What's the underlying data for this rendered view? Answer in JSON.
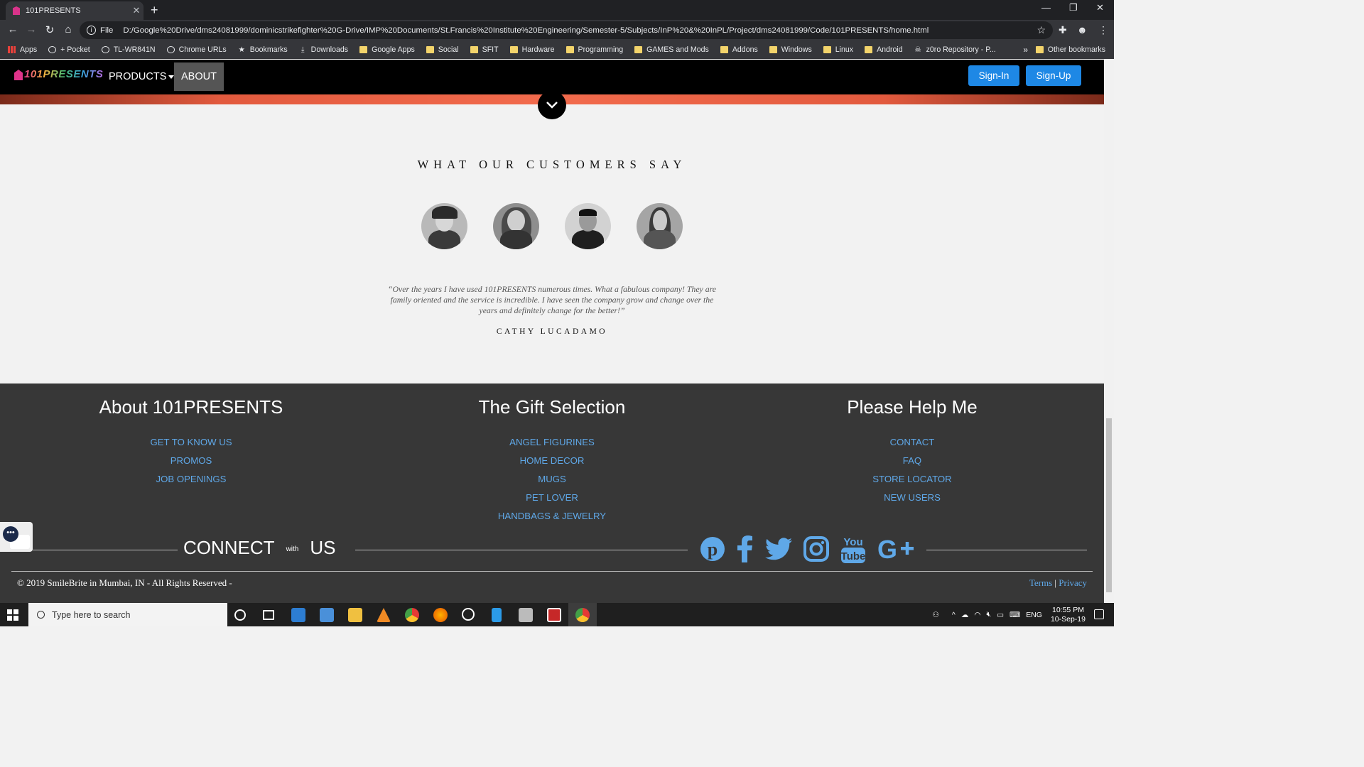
{
  "browser": {
    "tab_title": "101PRESENTS",
    "tab_close": "✕",
    "new_tab": "+",
    "window_controls": {
      "minimize": "—",
      "restore": "❐",
      "close": "✕"
    },
    "url_scheme": "File",
    "url": "D:/Google%20Drive/dms24081999/dominicstrikefighter%20G-Drive/IMP%20Documents/St.Francis%20Institute%20Engineering/Semester-5/Subjects/InP%20&%20InPL/Project/dms24081999/Code/101PRESENTS/home.html",
    "bookmarks": [
      {
        "label": "Apps",
        "icon": "apps-grid-icon"
      },
      {
        "label": "+ Pocket",
        "icon": "globe-icon"
      },
      {
        "label": "TL-WR841N",
        "icon": "globe-icon"
      },
      {
        "label": "Chrome URLs",
        "icon": "globe-icon"
      },
      {
        "label": "Bookmarks",
        "icon": "star-icon"
      },
      {
        "label": "Downloads",
        "icon": "download-icon"
      },
      {
        "label": "Google Apps",
        "icon": "folder-icon"
      },
      {
        "label": "Social",
        "icon": "folder-icon"
      },
      {
        "label": "SFIT",
        "icon": "folder-icon"
      },
      {
        "label": "Hardware",
        "icon": "folder-icon"
      },
      {
        "label": "Programming",
        "icon": "folder-icon"
      },
      {
        "label": "GAMES and Mods",
        "icon": "folder-icon"
      },
      {
        "label": "Addons",
        "icon": "folder-icon"
      },
      {
        "label": "Windows",
        "icon": "folder-icon"
      },
      {
        "label": "Linux",
        "icon": "folder-icon"
      },
      {
        "label": "Android",
        "icon": "folder-icon"
      },
      {
        "label": "z0ro Repository - P...",
        "icon": "bug-icon"
      }
    ],
    "bookmarks_more": "»",
    "other_bookmarks": "Other bookmarks"
  },
  "site": {
    "logo": "101PRESENTS",
    "nav": {
      "products": "PRODUCTS",
      "about": "ABOUT"
    },
    "auth": {
      "signin": "Sign-In",
      "signup": "Sign-Up"
    },
    "testimonials": {
      "title": "WHAT OUR CUSTOMERS SAY",
      "quote": "“Over the years I have used 101PRESENTS numerous times. What a fabulous company! They are family oriented and the service is incredible. I have seen the company grow and change over the years and definitely change for the better!”",
      "author": "CATHY LUCADAMO"
    },
    "footer": {
      "col1": {
        "title": "About 101PRESENTS",
        "links": [
          "GET TO KNOW US",
          "PROMOS",
          "JOB OPENINGS"
        ]
      },
      "col2": {
        "title": "The Gift Selection",
        "links": [
          "ANGEL FIGURINES",
          "HOME DECOR",
          "MUGS",
          "PET LOVER",
          "HANDBAGS & JEWELRY"
        ]
      },
      "col3": {
        "title": "Please Help Me",
        "links": [
          "CONTACT",
          "FAQ",
          "STORE LOCATOR",
          "NEW USERS"
        ]
      },
      "connect": {
        "pre": "CONNECT",
        "with": "with",
        "post": "US"
      },
      "social": [
        "pinterest-icon",
        "facebook-icon",
        "twitter-icon",
        "instagram-icon",
        "youtube-icon",
        "google-plus-icon"
      ],
      "copyright": "© 2019 SmileBrite in Mumbai, IN - All Rights Reserved -",
      "terms": "Terms",
      "separator": "|",
      "privacy": "Privacy"
    }
  },
  "taskbar": {
    "search_placeholder": "Type here to search",
    "language": "ENG",
    "time": "10:55 PM",
    "date": "10-Sep-19"
  },
  "colors": {
    "accent_blue": "#1e88e5",
    "footer_link": "#5fa8e8",
    "footer_bg": "#373737",
    "nav_bg": "#000000",
    "about_active": "#555555"
  }
}
